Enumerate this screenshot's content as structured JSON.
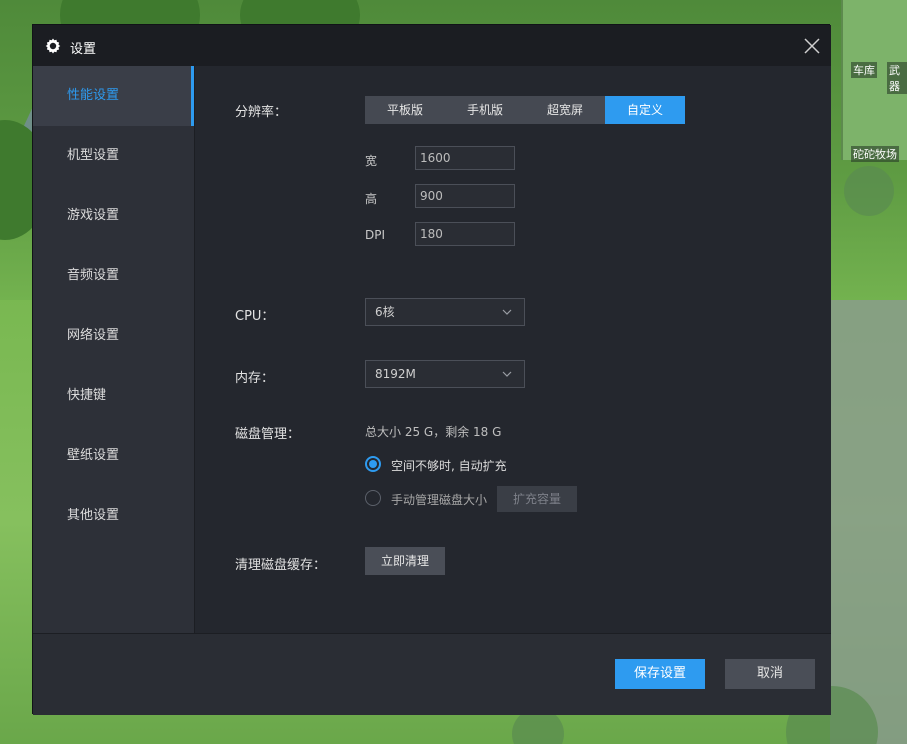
{
  "window": {
    "title": "设置",
    "icon": "gear-icon",
    "close_icon": "close-icon"
  },
  "background": {
    "minimap_labels": [
      "车库",
      "武器",
      "砣砣牧场"
    ]
  },
  "sidebar": {
    "items": [
      {
        "label": "性能设置",
        "active": true
      },
      {
        "label": "机型设置",
        "active": false
      },
      {
        "label": "游戏设置",
        "active": false
      },
      {
        "label": "音频设置",
        "active": false
      },
      {
        "label": "网络设置",
        "active": false
      },
      {
        "label": "快捷键",
        "active": false
      },
      {
        "label": "壁纸设置",
        "active": false
      },
      {
        "label": "其他设置",
        "active": false
      }
    ]
  },
  "performance": {
    "resolution": {
      "label": "分辨率：",
      "options": [
        "平板版",
        "手机版",
        "超宽屏",
        "自定义"
      ],
      "selected": "自定义",
      "width_label": "宽",
      "width_value": "1600",
      "height_label": "高",
      "height_value": "900",
      "dpi_label": "DPI",
      "dpi_value": "180"
    },
    "cpu": {
      "label": "CPU：",
      "value": "6核"
    },
    "memory": {
      "label": "内存：",
      "value": "8192M"
    },
    "disk": {
      "label": "磁盘管理：",
      "summary": "总大小 25 G，剩余 18 G",
      "auto_expand_label": "空间不够时, 自动扩充",
      "manual_label": "手动管理磁盘大小",
      "expand_button": "扩充容量"
    },
    "cache": {
      "label": "清理磁盘缓存：",
      "button": "立即清理"
    }
  },
  "footer": {
    "save_label": "保存设置",
    "cancel_label": "取消"
  },
  "colors": {
    "accent": "#2e9bf0",
    "panel": "#24272e",
    "sidebar": "#2d3038",
    "titlebar": "#1b1d22"
  }
}
